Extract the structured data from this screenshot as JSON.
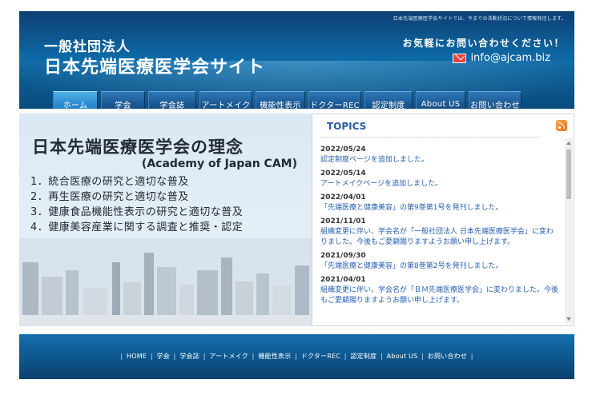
{
  "header": {
    "top_notice": "日本先端医療医学会サイトでは、今までの活動状況について情報発信します。",
    "org_name": "一般社団法人",
    "site_title": "日本先端医療医学会サイト",
    "contact_prompt": "お気軽にお問い合わせください！",
    "contact_email": "info@ajcam.biz",
    "email_icon": "mail-icon"
  },
  "nav": {
    "items": [
      {
        "label": "ホーム",
        "active": true
      },
      {
        "label": "学会"
      },
      {
        "label": "学会誌"
      },
      {
        "label": "アートメイク"
      },
      {
        "label": "機能性表示"
      },
      {
        "label": "ドクターREC"
      },
      {
        "label": "認定制度"
      },
      {
        "label": "About US"
      },
      {
        "label": "お問い合わせ"
      }
    ]
  },
  "hero": {
    "title": "日本先端医療医学会の理念",
    "subtitle": "(Academy of Japan CAM)",
    "principles": [
      "1．統合医療の研究と適切な普及",
      "2．再生医療の研究と適切な普及",
      "3．健康食品機能性表示の研究と適切な普及",
      "4．健康美容産業に関する調査と推奨・認定"
    ]
  },
  "topics": {
    "title": "TOPICS",
    "rss_icon": "rss-icon",
    "items": [
      {
        "date": "2022/05/24",
        "text": "認定制度ページを追加しました。"
      },
      {
        "date": "2022/05/14",
        "text": "アートメイクページを追加しました。"
      },
      {
        "date": "2022/04/01",
        "text": "「先端医療と健康美容」の第9巻第1号を発刊しました。"
      },
      {
        "date": "2021/11/01",
        "text": "組織変更に伴い、学会名が「一般社団法人 日本先端医療医学会」に変わりました。今後もご愛顧賜りますようお願い申し上げます。"
      },
      {
        "date": "2021/09/30",
        "text": "「先端医療と健康美容」の第8巻第2号を発刊しました。"
      },
      {
        "date": "2021/04/01",
        "text": "組織変更に伴い、学会名が「ＢＭ先端医療医学会」に変わりました。今後もご愛顧賜りますようお願い申し上げます。"
      }
    ]
  },
  "footer": {
    "links": [
      "HOME",
      "学会",
      "学会誌",
      "アートメイク",
      "機能性表示",
      "ドクターREC",
      "認定制度",
      "About US",
      "お問い合わせ"
    ]
  },
  "colors": {
    "header_blue": "#0d6aa6",
    "nav_active": "#2a8cd0",
    "topics_title": "#2a5aa0",
    "topic_link": "#2860b0",
    "email_icon_red": "#e8423c",
    "rss_orange": "#e9731f"
  }
}
